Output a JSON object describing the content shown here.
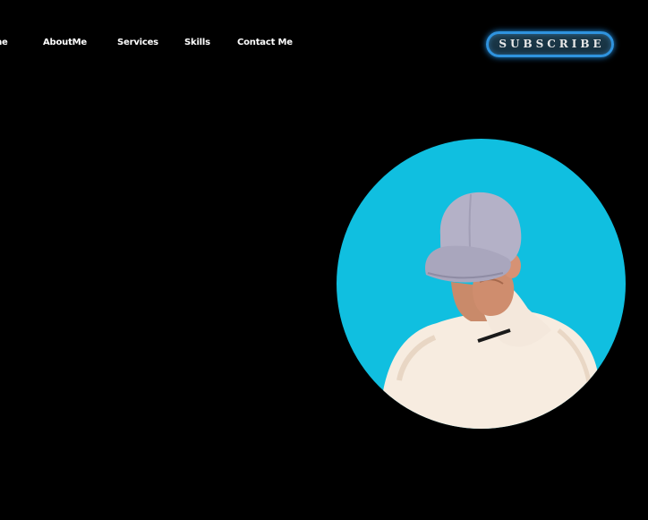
{
  "nav": {
    "items": [
      {
        "label": "Home"
      },
      {
        "label": "AboutMe"
      },
      {
        "label": "Services"
      },
      {
        "label": "Skills"
      },
      {
        "label": "Contact Me"
      }
    ]
  },
  "header": {
    "subscribe_label": "SUBSCRIBE"
  },
  "hero": {
    "portrait_icon": "person-wearing-cap-photo",
    "portrait_bg_color": "#10bfe0"
  },
  "colors": {
    "background": "#000000",
    "accent": "#2f93de"
  }
}
